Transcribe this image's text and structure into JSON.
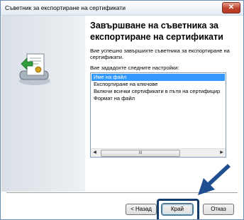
{
  "window": {
    "title": "Съветник за експортиране на сертификати",
    "close_glyph": "✕"
  },
  "heading": "Завършване на съветника за експортиране на сертификати",
  "message": "Вие успешно завършихте съветника за експортиране на сертификати.",
  "settings_label": "Вие зададохте следните настройки:",
  "settings_list": [
    "Име на файл",
    "Експортиране на ключове",
    "Включи всички сертификати в пътя на сертифицир",
    "Формат на файл"
  ],
  "scrollbar": {
    "left_arrow": "◀",
    "right_arrow": "▶",
    "thumb_grip": "III"
  },
  "buttons": {
    "back": "< Назад",
    "finish": "Край",
    "cancel": "Отказ"
  },
  "colors": {
    "selection": "#3399ff",
    "highlight_border": "#163c6e",
    "pointer_arrow": "#1f4f8f"
  },
  "icons": {
    "wizard_art": "certificate-export-icon",
    "pointer": "pointer-arrow-icon"
  }
}
